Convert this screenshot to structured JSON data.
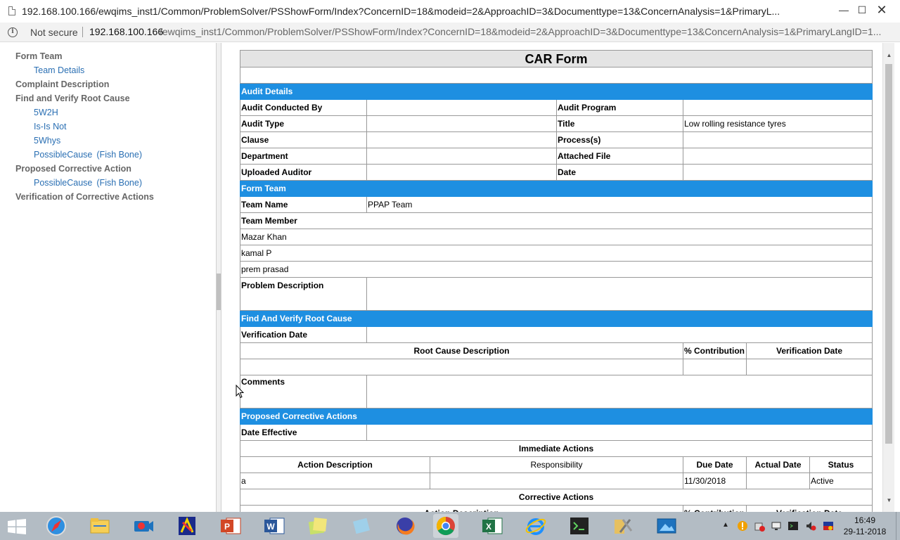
{
  "window": {
    "title": "192.168.100.166/ewqims_inst1/Common/ProblemSolver/PSShowForm/Index?ConcernID=18&modeid=2&ApproachID=3&Documenttype=13&ConcernAnalysis=1&PrimaryL..."
  },
  "address_bar": {
    "security_label": "Not secure",
    "host": "192.168.100.166",
    "path": "/ewqims_inst1/Common/ProblemSolver/PSShowForm/Index?ConcernID=18&modeid=2&ApproachID=3&Documenttype=13&ConcernAnalysis=1&PrimaryLangID=1..."
  },
  "nav": {
    "form_team": "Form Team",
    "team_details": "Team Details",
    "complaint_description": "Complaint Description",
    "find_verify_root_cause": "Find and Verify Root Cause",
    "w2h": "5W2H",
    "is_is_not": "Is-Is Not",
    "whys": "5Whys",
    "possible_cause_1": "PossibleCause",
    "fish_bone_1": "(Fish Bone)",
    "proposed_corrective_action": "Proposed Corrective Action",
    "possible_cause_2": "PossibleCause",
    "fish_bone_2": "(Fish Bone)",
    "verification_corrective_actions": "Verification of Corrective Actions"
  },
  "form": {
    "title": "CAR Form",
    "audit_details": {
      "header": "Audit Details",
      "audit_conducted_by_label": "Audit Conducted By",
      "audit_conducted_by_value": "",
      "audit_program_label": "Audit Program",
      "audit_program_value": "",
      "audit_type_label": "Audit Type",
      "audit_type_value": "",
      "title_label": "Title",
      "title_value": "Low rolling resistance tyres",
      "clause_label": "Clause",
      "clause_value": "",
      "processes_label": "Process(s)",
      "processes_value": "",
      "department_label": "Department",
      "department_value": "",
      "attached_file_label": "Attached File",
      "uploaded_auditor_label": "Uploaded Auditor",
      "uploaded_auditor_value": "",
      "date_label": "Date"
    },
    "form_team": {
      "header": "Form Team",
      "team_name_label": "Team Name",
      "team_name_value": "PPAP Team",
      "team_member_label": "Team Member",
      "members": [
        "Mazar Khan",
        "kamal P",
        "prem prasad"
      ]
    },
    "problem_description_label": "Problem Description",
    "root_cause": {
      "header": "Find And Verify Root Cause",
      "verification_date_label": "Verification Date",
      "col_description": "Root Cause Description",
      "col_contribution": "% Contribution",
      "col_verification_date": "Verification Date",
      "comments_label": "Comments"
    },
    "corrective": {
      "header": "Proposed Corrective Actions",
      "date_effective_label": "Date Effective",
      "immediate_actions_label": "Immediate Actions",
      "col_action_description": "Action Description",
      "col_responsibility": "Responsibility",
      "col_due_date": "Due Date",
      "col_actual_date": "Actual Date",
      "col_status": "Status",
      "immediate_rows": [
        {
          "description": "a",
          "responsibility": "",
          "due_date": "11/30/2018",
          "actual_date": "",
          "status": "Active"
        }
      ],
      "corrective_actions_label": "Corrective Actions",
      "col2_action_description": "Action Description",
      "col2_contribution": "% Contribution",
      "col2_verification_date": "Verification Date"
    }
  },
  "taskbar": {
    "time": "16:49",
    "date": "29-11-2018"
  },
  "colors": {
    "section_header": "#1e8fe1",
    "nav_link": "#2a6fb3",
    "nav_heading": "#666666",
    "taskbar": "#b3bcc4"
  }
}
